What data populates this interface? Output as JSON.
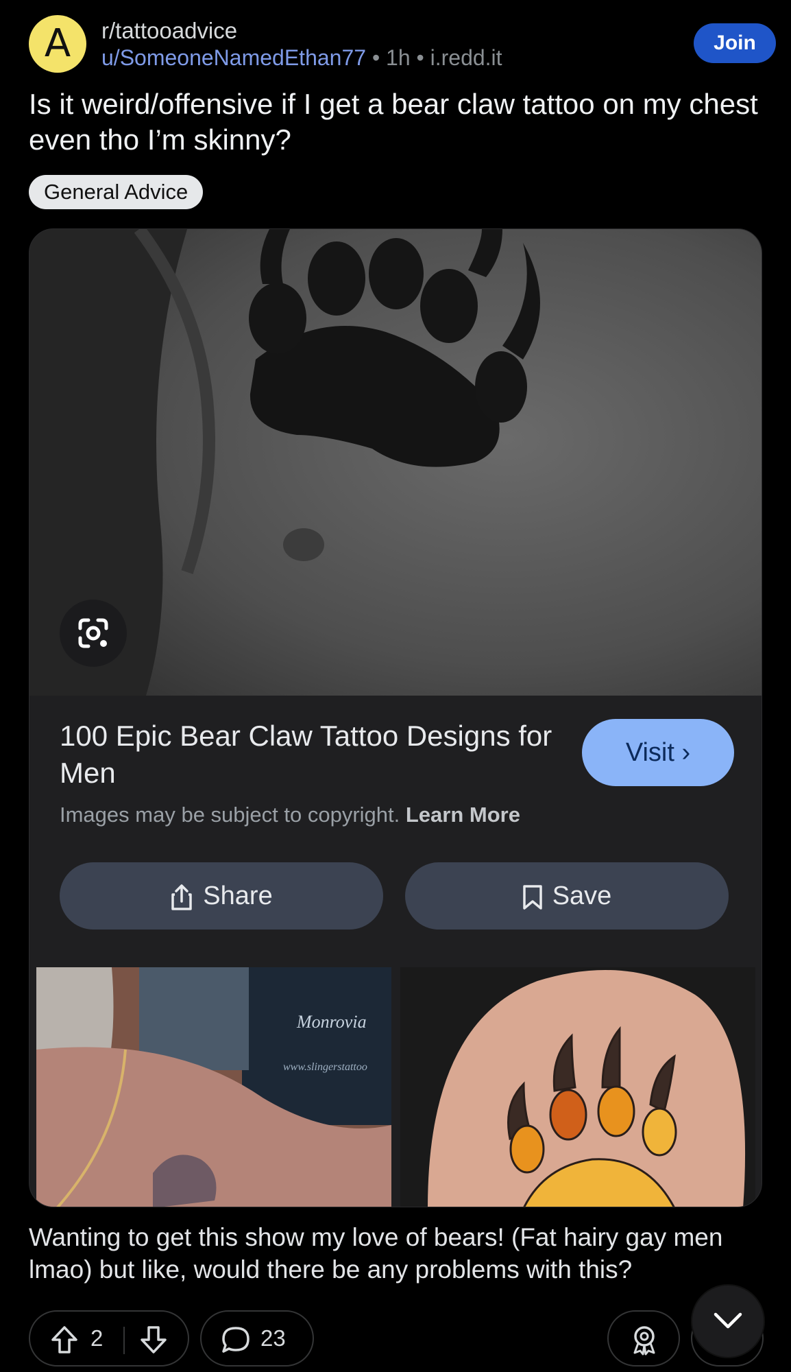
{
  "post": {
    "avatar_letter": "A",
    "subreddit": "r/tattooadvice",
    "username": "u/SomeoneNamedEthan77",
    "separator": " • ",
    "age": "1h",
    "domain": "i.redd.it",
    "join_label": "Join",
    "title": "Is it weird/offensive if I get a bear claw tattoo on my chest even tho I’m skinny?",
    "flair": "General Advice",
    "body": "Wanting to get this show my love of bears! (Fat hairy gay men lmao) but like, would there be any problems with this?",
    "upvotes": "2",
    "comments": "23"
  },
  "lens_card": {
    "result_title": "100 Epic Bear Claw Tattoo Designs for Men",
    "visit_label": "Visit",
    "visit_chevron": "›",
    "copyright_text": "Images may be subject to copyright.",
    "learn_more": "Learn More",
    "share_label": "Share",
    "save_label": "Save",
    "thumb_left_watermark": "Monrovia",
    "thumb_left_watermark_sub": "www.slingerstattoo"
  },
  "icons": {
    "lens": "google-lens-icon",
    "upvote": "arrow-up-icon",
    "downvote": "arrow-down-icon",
    "comment": "speech-bubble-icon",
    "award": "award-icon",
    "share": "share-icon",
    "bookmark": "bookmark-icon",
    "collapse": "chevron-down-icon"
  },
  "colors": {
    "join": "#1f55c8",
    "visit": "#8ab4f8",
    "pill": "#3c4352",
    "avatar": "#f4e36a"
  }
}
